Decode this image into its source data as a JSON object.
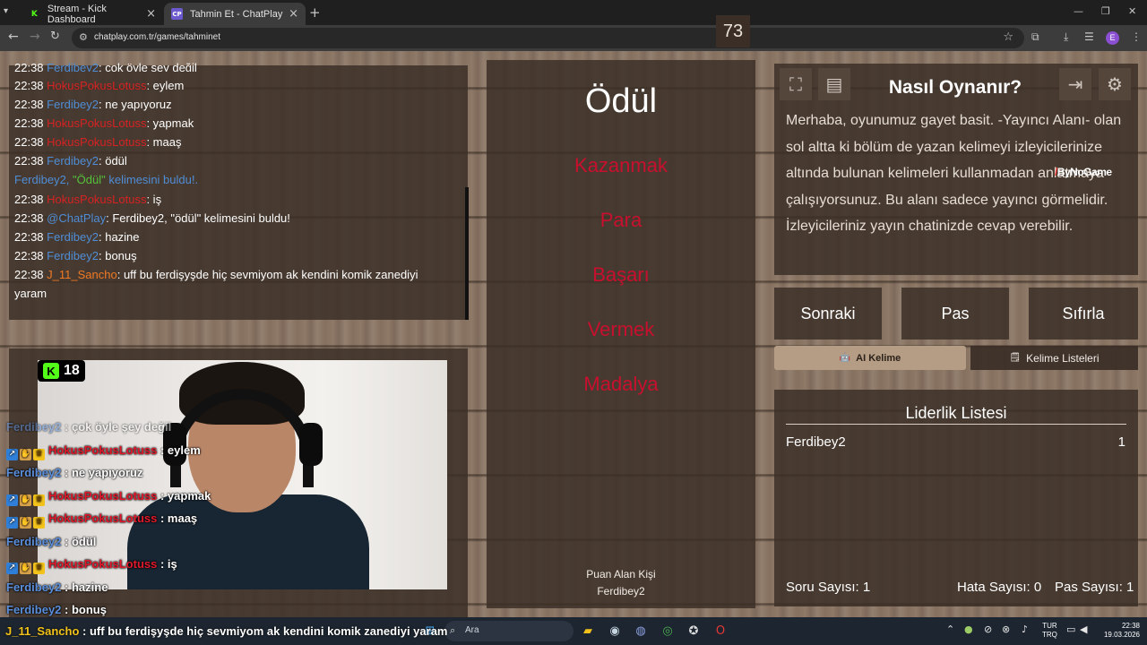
{
  "browser": {
    "tabs": [
      {
        "title": "Stream - Kick Dashboard"
      },
      {
        "title": "Tahmin Et - ChatPlay"
      }
    ],
    "url": "chatplay.com.tr/games/tahminet",
    "profile_initial": "E"
  },
  "chat": {
    "lines": [
      {
        "time": "22:38",
        "user": "Ferdibey2",
        "msg": ": çok öyle şey değil"
      },
      {
        "time": "22:38",
        "user": "HokusPokusLotuss",
        "msg": ": eylem"
      },
      {
        "time": "22:38",
        "user": "Ferdibey2",
        "msg": ": ne yapıyoruz"
      },
      {
        "time": "22:38",
        "user": "HokusPokusLotuss",
        "msg": ": yapmak"
      },
      {
        "time": "22:38",
        "user": "HokusPokusLotuss",
        "msg": ": maaş"
      },
      {
        "time": "22:38",
        "user": "Ferdibey2",
        "msg": ": ödül"
      },
      {
        "time": "22:38",
        "user": "HokusPokusLotuss",
        "msg": ": iş"
      },
      {
        "time": "22:38",
        "user": "@ChatPlay",
        "msg": ": Ferdibey2, \"ödül\" kelimesini buldu!"
      },
      {
        "time": "22:38",
        "user": "Ferdibey2",
        "msg": ": hazine"
      },
      {
        "time": "22:38",
        "user": "Ferdibey2",
        "msg": ": bonuş"
      },
      {
        "time": "22:38",
        "user": "J_11_Sancho",
        "msg": ": uff bu ferdişyşde hiç sevmiyom ak kendini komik zanediyi"
      },
      {
        "cont": "yaram"
      }
    ],
    "found_notice": {
      "user": "Ferdibey2, ",
      "word": "\"Ödül\"",
      "rest": " kelimesini buldu!."
    }
  },
  "stream_overlay": {
    "badge": {
      "k": "K",
      "number": "18"
    },
    "lines": [
      {
        "user": "Ferdibey2",
        "msg": " : çok öyle şey değil"
      },
      {
        "user": "HokusPokusLotuss",
        "msg": " : eylem"
      },
      {
        "user": "Ferdibey2",
        "msg": " : ne yapıyoruz"
      },
      {
        "user": "HokusPokusLotuss",
        "msg": " : yapmak"
      },
      {
        "user": "HokusPokusLotuss",
        "msg": " : maaş"
      },
      {
        "user": "Ferdibey2",
        "msg": " : ödül"
      },
      {
        "user": "HokusPokusLotuss",
        "msg": " : iş"
      },
      {
        "user": "Ferdibey2",
        "msg": " : hazine"
      },
      {
        "user": "Ferdibey2",
        "msg": " : bonuş"
      }
    ],
    "ticker": {
      "user": "J_11_Sancho",
      "msg": " : uff bu ferdişyşde hiç sevmiyom ak kendini komik zanediyi yaram"
    }
  },
  "game": {
    "timer": "73",
    "word": "Ödül",
    "forbidden": [
      "Kazanmak",
      "Para",
      "Başarı",
      "Vermek",
      "Madalya"
    ],
    "scorer_label": "Puan Alan Kişi",
    "scorer_name": "Ferdibey2"
  },
  "howto": {
    "title": "Nasıl Oynanır?",
    "text": "Merhaba, oyunumuz gayet basit. -Yayıncı Alanı- olan sol altta ki bölüm de yazan kelimeyi izleyicilerinize altında bulunan kelimeleri kullanmadan anlatmaya çalışıyorsunuz. Bu alanı sadece yayıncı görmelidir. İzleyicileriniz yayın chatinizde cevap verebilir.",
    "watermark": "ByNoGame"
  },
  "controls": {
    "next": "Sonraki",
    "pass": "Pas",
    "reset": "Sıfırla"
  },
  "tabs": {
    "ai": "AI Kelime",
    "lists": "Kelime Listeleri"
  },
  "leaderboard": {
    "title": "Liderlik Listesi",
    "rows": [
      {
        "name": "Ferdibey2",
        "score": "1"
      }
    ]
  },
  "stats": {
    "questions": "Soru Sayısı: 1",
    "errors": "Hata Sayısı: 0",
    "passes": "Pas Sayısı: 1"
  },
  "taskbar": {
    "search": "Ara",
    "lang_line1": "TUR",
    "lang_line2": "TRQ",
    "time": "22:38",
    "date": "19.03.2026"
  },
  "colors": {
    "wood": "#86715f",
    "panel": "#3a2e26",
    "forbidden": "#c8102e",
    "kick_green": "#53fc18"
  }
}
